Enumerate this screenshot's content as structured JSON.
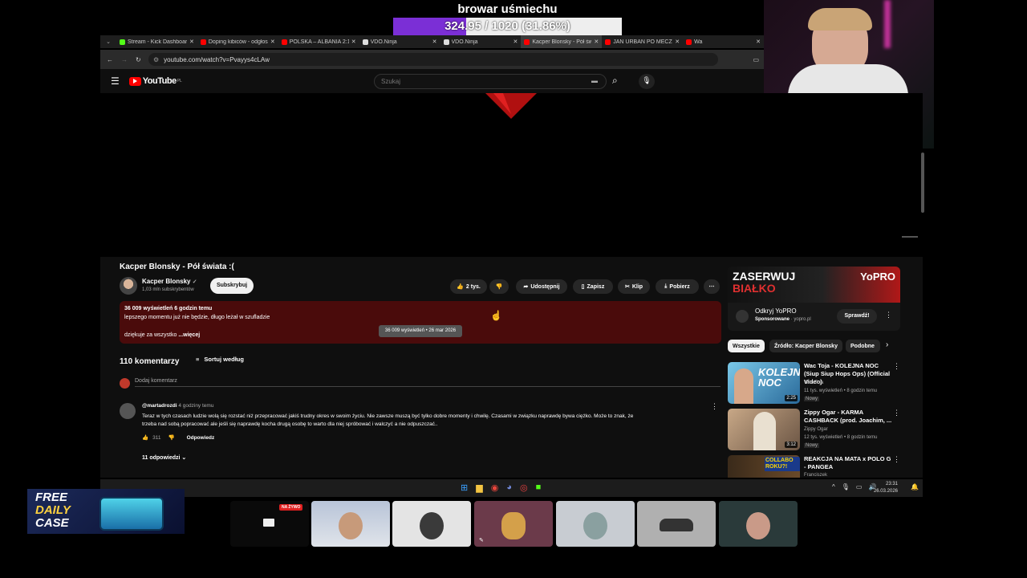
{
  "overlay": {
    "title": "browar uśmiechu",
    "progress_text": "324.95 / 1020 (31.86%)",
    "progress_fraction": 0.3186,
    "accent": "#7b2fd6"
  },
  "browser": {
    "tabs": [
      {
        "label": "Stream - Kick Dashboard",
        "color": "#53fc18"
      },
      {
        "label": "Doping kibiców - odgłos",
        "color": "#ff0000"
      },
      {
        "label": "POLSKA – ALBANIA 2:1",
        "color": "#ff0000"
      },
      {
        "label": "VDO.Ninja",
        "color": "#dddddd"
      },
      {
        "label": "VDO.Ninja",
        "color": "#dddddd"
      },
      {
        "label": "Kacper Blonsky - Pół świa",
        "color": "#ff0000"
      },
      {
        "label": "JAN URBAN PO MECZU",
        "color": "#ff0000"
      },
      {
        "label": "Wa",
        "color": "#ff0000"
      }
    ],
    "url": "youtube.com/watch?v=Pvayys4cLAw"
  },
  "youtube": {
    "logo": "YouTube",
    "region": "PL",
    "search_placeholder": "Szukaj"
  },
  "video": {
    "title": "Kacper Blonsky - Pół świata :(",
    "channel": "Kacper Blonsky",
    "subscribers": "1,03 mln subskrybentów",
    "subscribe_label": "Subskrybuj",
    "likes": "2 tys.",
    "share_label": "Udostępnij",
    "save_label": "Zapisz",
    "clip_label": "Klip",
    "download_label": "Pobierz",
    "description": {
      "meta": "36 009 wyświetleń  6 godzin temu",
      "line1": "lepszego momentu już nie będzie, długo leżał w szufladzie",
      "line2": "dziękuje za wszystko",
      "more": "...więcej"
    },
    "tooltip": "36 009 wyświetleń • 26 mar 2026"
  },
  "comments": {
    "count_label": "110 komentarzy",
    "sort_label": "Sortuj według",
    "add_placeholder": "Dodaj komentarz",
    "items": [
      {
        "author": "@martadrozdi",
        "time": "4 godziny temu",
        "text1": "Teraz w tych czasach ludzie wolą się rozstać niż przepracować jakiś trudny okres w swoim życiu. Nie zawsze muszą być tylko dobre momenty i chwilę. Czasami w związku naprawdę bywa ciężko. Może to znak, że",
        "text2": "trzeba nad sobą popracować ale jeśli się naprawdę kocha drugą osobę to warto dla niej spróbować i walczyć a nie odpuszczać..",
        "likes": "311",
        "reply_label": "Odpowiedz",
        "replies_label": "11 odpowiedzi"
      }
    ]
  },
  "ad": {
    "brand_text": "ZASERWUJ",
    "brand_text2": "BIAŁKO",
    "brand_logo": "YoPRO",
    "title": "Odkryj YoPRO",
    "sponsor": "Sponsorowane",
    "domain": "yopro.pl",
    "cta": "Sprawdź!"
  },
  "filters": [
    "Wszystkie",
    "Źródło: Kacper Blonsky",
    "Podobne"
  ],
  "recommendations": [
    {
      "title": "Wac Toja - KOLEJNA NOC (Siup Siup Hops Ops) (Official Video)",
      "channel": "Wac Toja",
      "stats": "11 tys. wyświetleń • 8 godzin temu",
      "badge": "Nowy",
      "duration": "2:25",
      "thumb_text": "KOLEJNA NOC"
    },
    {
      "title": "Zippy Ogar - KARMA CASHBACK (prod. Joachim, ...",
      "channel": "Zippy Ogar",
      "stats": "12 tys. wyświetleń • 8 godzin temu",
      "badge": "Nowy",
      "duration": "3:12",
      "thumb_text": ""
    },
    {
      "title": "REAKCJA NA MATA x POLO G - PANGEA",
      "channel": "Franciszek",
      "stats": "",
      "badge": "",
      "duration": "",
      "thumb_text": "COLLABO ROKU?!"
    }
  ],
  "taskbar": {
    "time": "23:31",
    "date": "26.03.2026"
  },
  "promo": {
    "line1": "FREE",
    "line2": "DAILY",
    "line3": "CASE"
  },
  "live_badge": "NA ŻYWO"
}
